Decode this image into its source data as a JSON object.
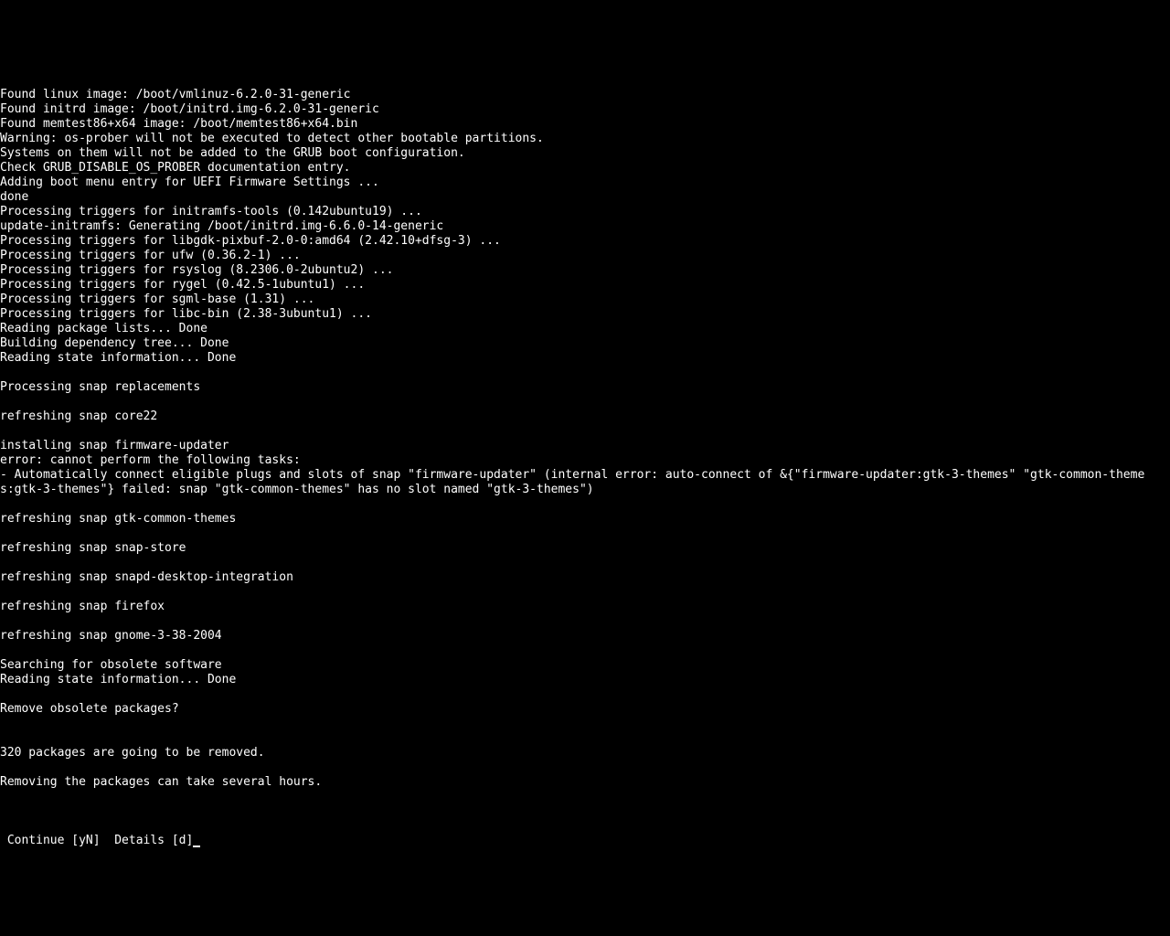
{
  "terminal": {
    "lines": [
      "Found linux image: /boot/vmlinuz-6.2.0-31-generic",
      "Found initrd image: /boot/initrd.img-6.2.0-31-generic",
      "Found memtest86+x64 image: /boot/memtest86+x64.bin",
      "Warning: os-prober will not be executed to detect other bootable partitions.",
      "Systems on them will not be added to the GRUB boot configuration.",
      "Check GRUB_DISABLE_OS_PROBER documentation entry.",
      "Adding boot menu entry for UEFI Firmware Settings ...",
      "done",
      "Processing triggers for initramfs-tools (0.142ubuntu19) ...",
      "update-initramfs: Generating /boot/initrd.img-6.6.0-14-generic",
      "Processing triggers for libgdk-pixbuf-2.0-0:amd64 (2.42.10+dfsg-3) ...",
      "Processing triggers for ufw (0.36.2-1) ...",
      "Processing triggers for rsyslog (8.2306.0-2ubuntu2) ...",
      "Processing triggers for rygel (0.42.5-1ubuntu1) ...",
      "Processing triggers for sgml-base (1.31) ...",
      "Processing triggers for libc-bin (2.38-3ubuntu1) ...",
      "Reading package lists... Done",
      "Building dependency tree... Done",
      "Reading state information... Done",
      "",
      "Processing snap replacements",
      "",
      "refreshing snap core22",
      "",
      "installing snap firmware-updater",
      "error: cannot perform the following tasks:",
      "- Automatically connect eligible plugs and slots of snap \"firmware-updater\" (internal error: auto-connect of &{\"firmware-updater:gtk-3-themes\" \"gtk-common-theme",
      "s:gtk-3-themes\"} failed: snap \"gtk-common-themes\" has no slot named \"gtk-3-themes\")",
      "",
      "refreshing snap gtk-common-themes",
      "",
      "refreshing snap snap-store",
      "",
      "refreshing snap snapd-desktop-integration",
      "",
      "refreshing snap firefox",
      "",
      "refreshing snap gnome-3-38-2004",
      "",
      "Searching for obsolete software",
      "Reading state information... Done",
      "",
      "Remove obsolete packages?",
      "",
      "",
      "320 packages are going to be removed.",
      "",
      "Removing the packages can take several hours.",
      ""
    ],
    "prompt": " Continue [yN]  Details [d]"
  }
}
